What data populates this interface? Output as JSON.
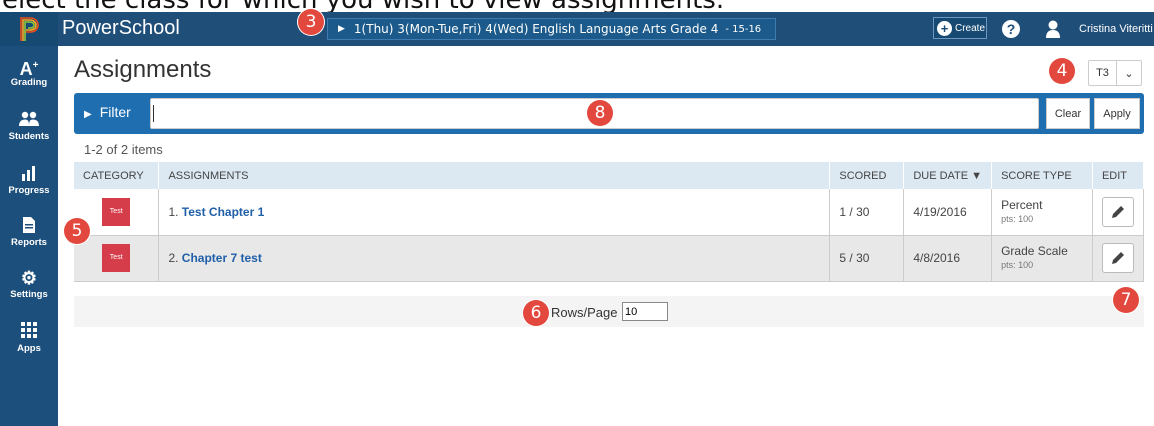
{
  "caption": "elect the class for which you wish to view assignments.",
  "topbar": {
    "brand": "PowerSchool",
    "class_selector": "1(Thu) 3(Mon-Tue,Fri) 4(Wed) English Language Arts Grade 4",
    "class_year": "- 15-16",
    "create_label": "Create",
    "help": "?",
    "user_name": "Cristina Viteritti"
  },
  "sidebar": {
    "items": [
      {
        "label": "Grading",
        "icon": "grading-icon"
      },
      {
        "label": "Students",
        "icon": "students-icon"
      },
      {
        "label": "Progress",
        "icon": "progress-icon"
      },
      {
        "label": "Reports",
        "icon": "reports-icon"
      },
      {
        "label": "Settings",
        "icon": "settings-icon"
      },
      {
        "label": "Apps",
        "icon": "apps-icon"
      }
    ]
  },
  "main": {
    "title": "Assignments",
    "term": "T3",
    "filter": {
      "label": "Filter",
      "value": "",
      "clear_label": "Clear",
      "apply_label": "Apply"
    },
    "count": "1-2 of 2 items",
    "table": {
      "headers": [
        "CATEGORY",
        "ASSIGNMENTS",
        "SCORED",
        "DUE DATE ▼",
        "SCORE TYPE",
        "EDIT"
      ],
      "rows": [
        {
          "category": "Test",
          "num": "1.",
          "name": "Test Chapter 1",
          "scored": "1 / 30",
          "due": "4/19/2016",
          "score_type": "Percent",
          "pts": "pts: 100"
        },
        {
          "category": "Test",
          "num": "2.",
          "name": "Chapter 7 test",
          "scored": "5 / 30",
          "due": "4/8/2016",
          "score_type": "Grade Scale",
          "pts": "pts: 100"
        }
      ]
    },
    "pager": {
      "label": "Rows/Page",
      "value": "10"
    }
  },
  "markers": [
    "3",
    "4",
    "5",
    "6",
    "7",
    "8"
  ],
  "colors": {
    "topbar": "#1f4e79",
    "sidebar": "#1d4f7c",
    "filter_bar": "#1f6fb0",
    "category_badge": "#d63d4a",
    "marker": "#e2483d",
    "link": "#1f5fa8"
  }
}
